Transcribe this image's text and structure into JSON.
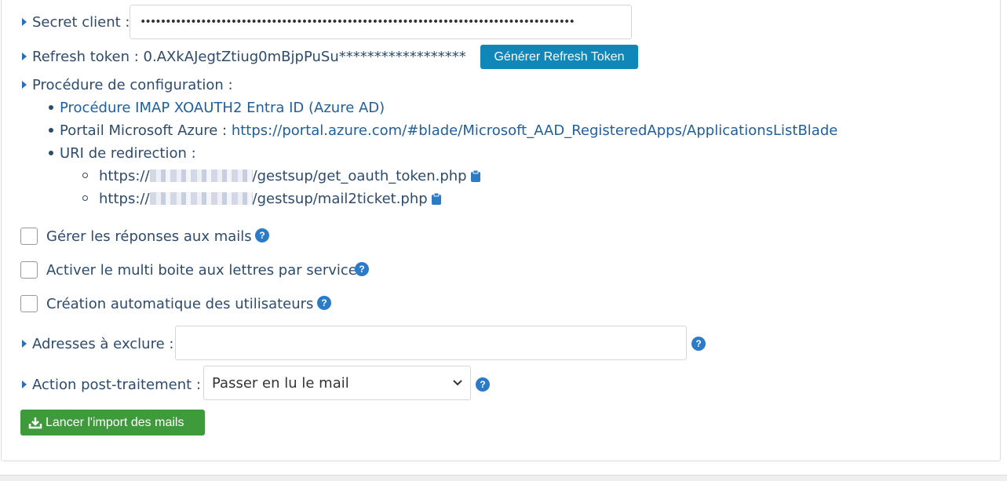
{
  "client_secret": {
    "label": "Secret client :",
    "value": "••••••••••••••••••••••••••••••••••••••••••••••••••••••••••••••••••••••••••••••••••••••"
  },
  "refresh_token": {
    "label": "Refresh token : 0.AXkAJegtZtiug0mBjpPuSu******************",
    "button": "Générer Refresh Token"
  },
  "procedure": {
    "label": "Procédure de configuration :",
    "items": [
      {
        "text": "Procédure IMAP XOAUTH2 Entra ID (Azure AD)"
      },
      {
        "prefix": "Portail Microsoft Azure : ",
        "link": "https://portal.azure.com/#blade/Microsoft_AAD_RegisteredApps/ApplicationsListBlade"
      },
      {
        "text": "URI de redirection :"
      }
    ],
    "redirects": [
      {
        "prefix": "https://",
        "suffix": "/gestsup/get_oauth_token.php"
      },
      {
        "prefix": "https://",
        "suffix": "/gestsup/mail2ticket.php"
      }
    ]
  },
  "options": {
    "manage_replies": "Gérer les réponses aux mails",
    "multi_mailbox": "Activer le multi boite aux lettres par service",
    "auto_create_users": "Création automatique des utilisateurs"
  },
  "exclude": {
    "label": "Adresses à exclure :",
    "value": ""
  },
  "post_action": {
    "label": "Action post-traitement :",
    "selected": "Passer en lu le mail"
  },
  "import_button": "Lancer l'import des mails",
  "colors": {
    "accent": "#0f87b8",
    "success": "#3f9a3c",
    "help": "#2b7bc9"
  }
}
